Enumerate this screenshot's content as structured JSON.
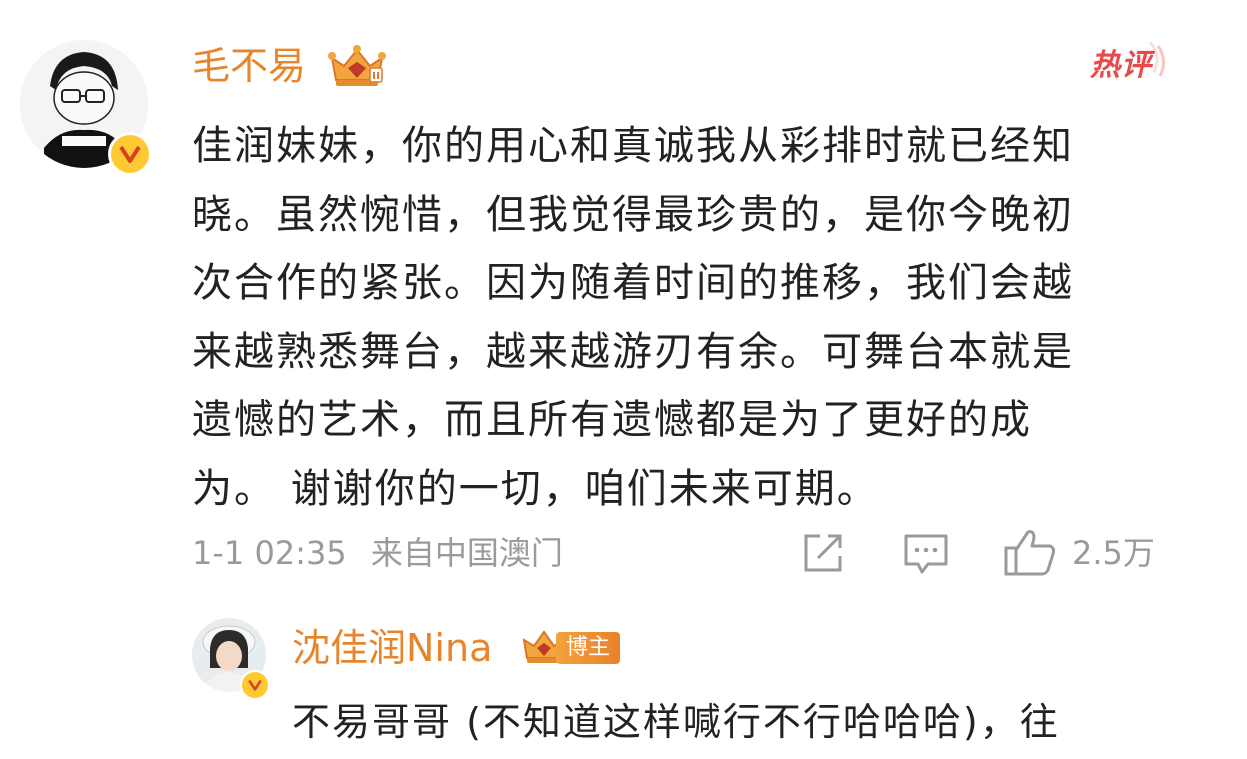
{
  "comment": {
    "username": "毛不易",
    "hot_label": "热评",
    "lines": [
      "佳润妹妹，你的用心和真诚我从彩排时就已经知",
      "晓。虽然惋惜，但我觉得最珍贵的，是你今晚初",
      "次合作的紧张。因为随着时间的推移，我们会越",
      "来越熟悉舞台，越来越游刃有余。可舞台本就是",
      "遗憾的艺术，而且所有遗憾都是为了更好的成",
      "为。 谢谢你的一切，咱们未来可期。"
    ],
    "timestamp": "1-1 02:35",
    "source": "来自中国澳门",
    "like_count": "2.5万"
  },
  "reply": {
    "username": "沈佳润Nina",
    "badge_label": "博主",
    "text": "不易哥哥 (不知道这样喊行不行哈哈哈)，往"
  },
  "colors": {
    "username": "#e8842a",
    "hot": "#e94949",
    "verified_badge": "#ffc933",
    "meta": "#9a9a9a"
  },
  "icons": [
    "verified-icon",
    "crown-badge-icon",
    "share-icon",
    "comment-icon",
    "like-icon"
  ]
}
